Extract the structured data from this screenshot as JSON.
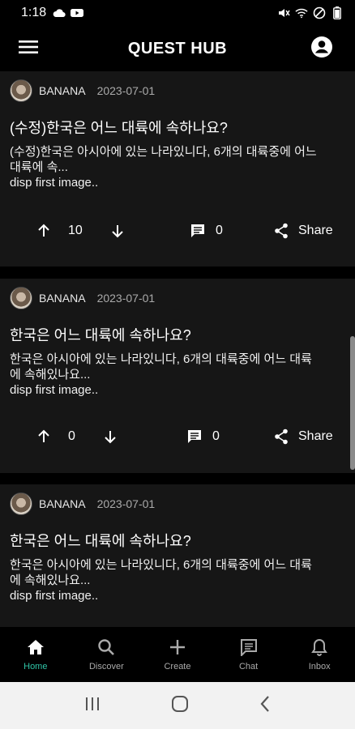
{
  "status_bar": {
    "time": "1:18",
    "left_icons": [
      "cloud-icon",
      "youtube-icon"
    ],
    "right_icons": [
      "mute-icon",
      "wifi-icon",
      "do-not-disturb-icon",
      "battery-icon"
    ]
  },
  "app_bar": {
    "title": "QUEST HUB",
    "menu_icon": "menu-icon",
    "profile_icon": "account-icon"
  },
  "posts": [
    {
      "author": "BANANA",
      "date": "2023-07-01",
      "title": "(수정)한국은 어느 대륙에 속하나요?",
      "body_line1": "(수정)한국은 아시아에 있는 나라있니다, 6개의 대륙중에 어느",
      "body_line2": "대륙에 속...",
      "body_line3": "disp first image..",
      "votes": "10",
      "comments": "0",
      "share": "Share"
    },
    {
      "author": "BANANA",
      "date": "2023-07-01",
      "title": "한국은 어느 대륙에 속하나요?",
      "body_line1": "한국은 아시아에 있는 나라있니다, 6개의 대륙중에 어느 대륙",
      "body_line2": "에 속해있나요...",
      "body_line3": "disp first image..",
      "votes": "0",
      "comments": "0",
      "share": "Share"
    },
    {
      "author": "BANANA",
      "date": "2023-07-01",
      "title": "한국은 어느 대륙에 속하나요?",
      "body_line1": "한국은 아시아에 있는 나라있니다, 6개의 대륙중에 어느 대륙",
      "body_line2": "에 속해있나요...",
      "body_line3": "disp first image.."
    }
  ],
  "bottom_nav": {
    "items": [
      {
        "label": "Home",
        "icon": "home-icon",
        "active": true
      },
      {
        "label": "Discover",
        "icon": "search-icon",
        "active": false
      },
      {
        "label": "Create",
        "icon": "plus-icon",
        "active": false
      },
      {
        "label": "Chat",
        "icon": "chat-icon",
        "active": false
      },
      {
        "label": "Inbox",
        "icon": "bell-icon",
        "active": false
      }
    ]
  },
  "colors": {
    "background": "#000000",
    "card": "#161616",
    "accent": "#2fc4a7",
    "text": "#ffffff",
    "muted": "#aaaaaa"
  }
}
